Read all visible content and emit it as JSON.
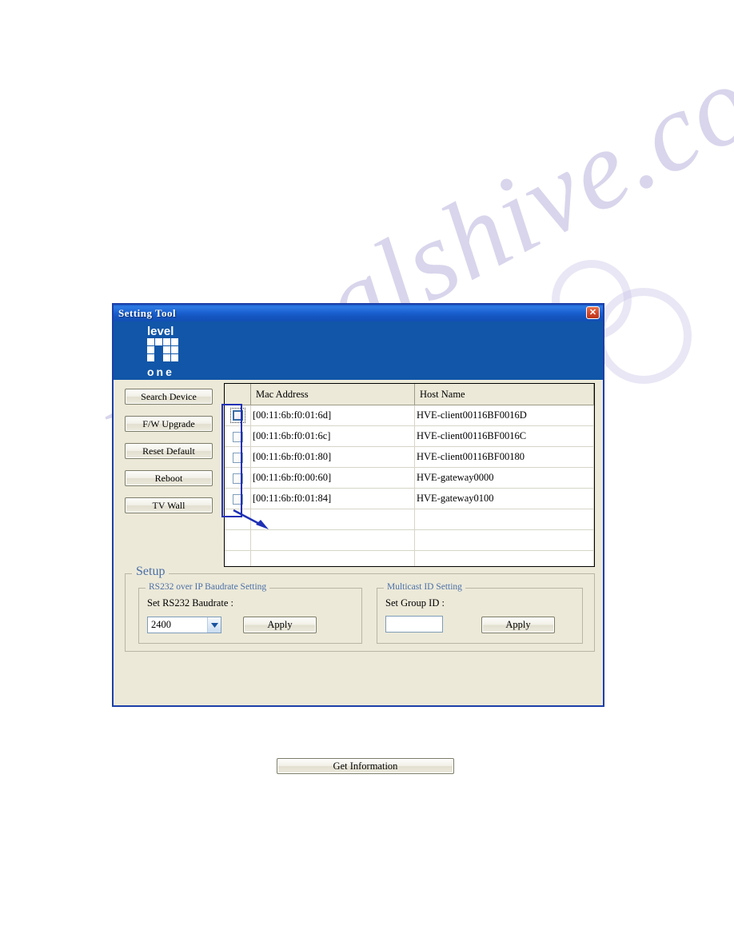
{
  "window": {
    "title": "Setting Tool",
    "close_label": "✕",
    "accent_title_color": "#1455bf",
    "body_color": "#ece9d8",
    "banner_color": "#1156a8",
    "annotation_color": "#1f30b5"
  },
  "logo": {
    "top_word": "level",
    "bottom_word": "one"
  },
  "buttons": [
    {
      "label": "Search Device",
      "name": "search-device-button"
    },
    {
      "label": "F/W Upgrade",
      "name": "fw-upgrade-button"
    },
    {
      "label": "Reset Default",
      "name": "reset-default-button"
    },
    {
      "label": "Reboot",
      "name": "reboot-button"
    },
    {
      "label": "TV Wall",
      "name": "tv-wall-button"
    }
  ],
  "table": {
    "columns": [
      "",
      "Mac Address",
      "Host Name"
    ],
    "rows": [
      {
        "checked": false,
        "focused": true,
        "mac": "[00:11:6b:f0:01:6d]",
        "host": "HVE-client00116BF0016D"
      },
      {
        "checked": false,
        "focused": false,
        "mac": "[00:11:6b:f0:01:6c]",
        "host": "HVE-client00116BF0016C"
      },
      {
        "checked": false,
        "focused": false,
        "mac": "[00:11:6b:f0:01:80]",
        "host": "HVE-client00116BF00180"
      },
      {
        "checked": false,
        "focused": false,
        "mac": "[00:11:6b:f0:00:60]",
        "host": "HVE-gateway0000"
      },
      {
        "checked": false,
        "focused": false,
        "mac": "[00:11:6b:f0:01:84]",
        "host": "HVE-gateway0100"
      }
    ],
    "empty_row_count": 4
  },
  "setup": {
    "legend": "Setup",
    "rs232": {
      "legend": "RS232 over IP Baudrate Setting",
      "field_label": "Set RS232 Baudrate :",
      "baudrate_value": "2400",
      "apply_label": "Apply"
    },
    "multicast": {
      "legend": "Multicast ID Setting",
      "field_label": "Set Group ID :",
      "group_id_value": "",
      "group_id_placeholder": "",
      "apply_label": "Apply"
    }
  },
  "footer": {
    "get_information_label": "Get Information"
  },
  "watermark": {
    "text": "manualshive.com"
  }
}
